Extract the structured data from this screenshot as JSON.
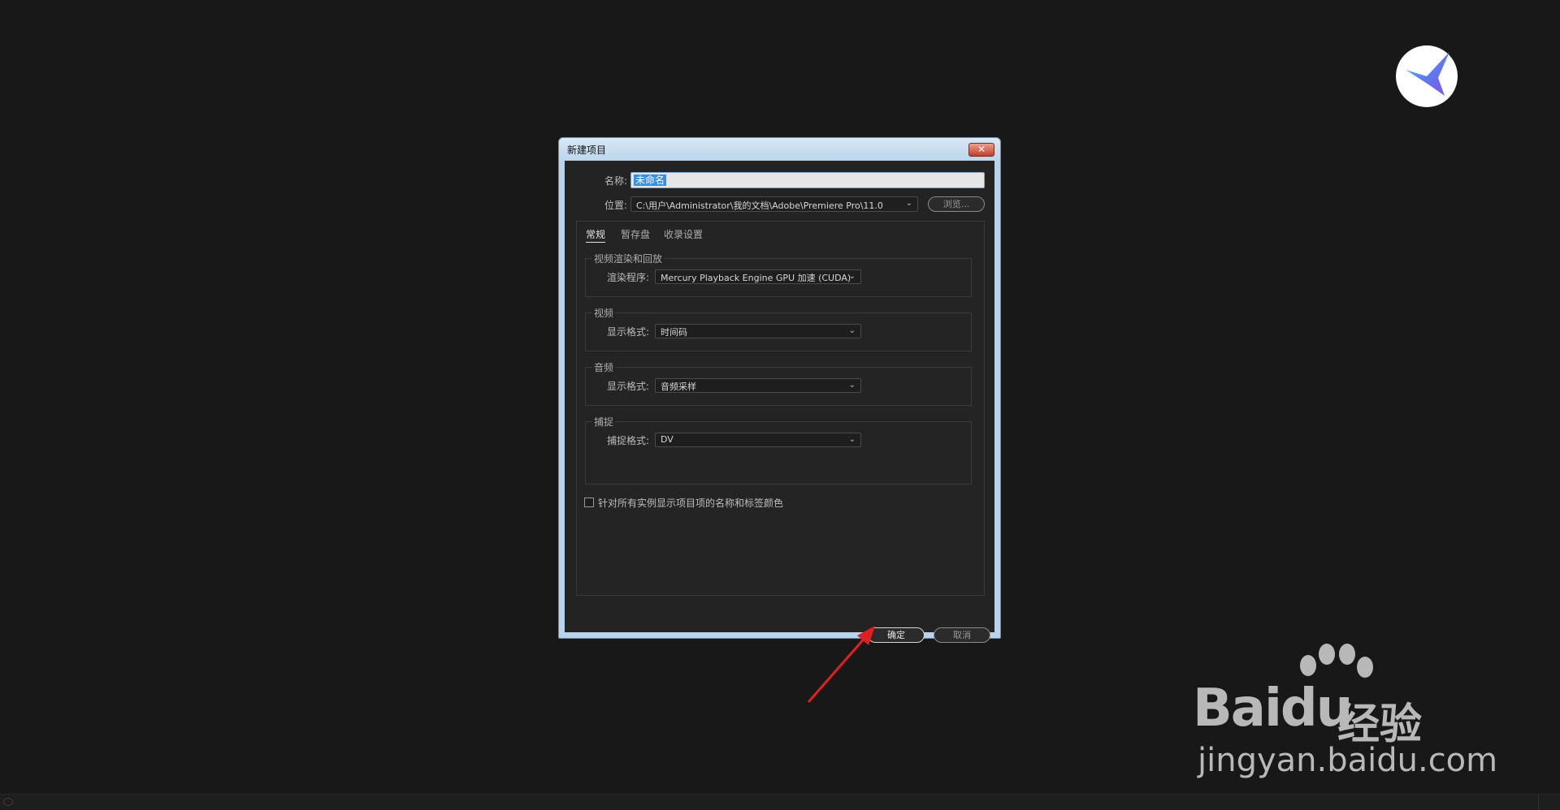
{
  "dialog": {
    "title": "新建项目",
    "close_glyph": "✕",
    "name_label": "名称:",
    "name_value": "未命名",
    "location_label": "位置:",
    "location_value": "C:\\用户\\Administrator\\我的文档\\Adobe\\Premiere Pro\\11.0",
    "browse_label": "浏览...",
    "tabs": [
      {
        "label": "常规"
      },
      {
        "label": "暂存盘"
      },
      {
        "label": "收录设置"
      }
    ],
    "groups": {
      "render": {
        "title": "视频渲染和回放",
        "label": "渲染程序:",
        "value": "Mercury Playback Engine GPU 加速 (CUDA)"
      },
      "video": {
        "title": "视频",
        "label": "显示格式:",
        "value": "时间码"
      },
      "audio": {
        "title": "音频",
        "label": "显示格式:",
        "value": "音频采样"
      },
      "capture": {
        "title": "捕捉",
        "label": "捕捉格式:",
        "value": "DV"
      }
    },
    "checkbox_label": "针对所有实例显示项目项的名称和标签颜色",
    "ok_label": "确定",
    "cancel_label": "取消"
  },
  "watermark": {
    "brand": "Baidu",
    "jingyan": "经验",
    "url": "jingyan.baidu.com"
  },
  "colors": {
    "background": "#181818",
    "dialog_frame": "#b9d3ea",
    "annotation": "#e02020",
    "selection": "#3b8de0"
  },
  "icons": {
    "app_logo": "bird-logo-icon",
    "dropdown": "chevron-down-icon",
    "close": "close-icon"
  }
}
